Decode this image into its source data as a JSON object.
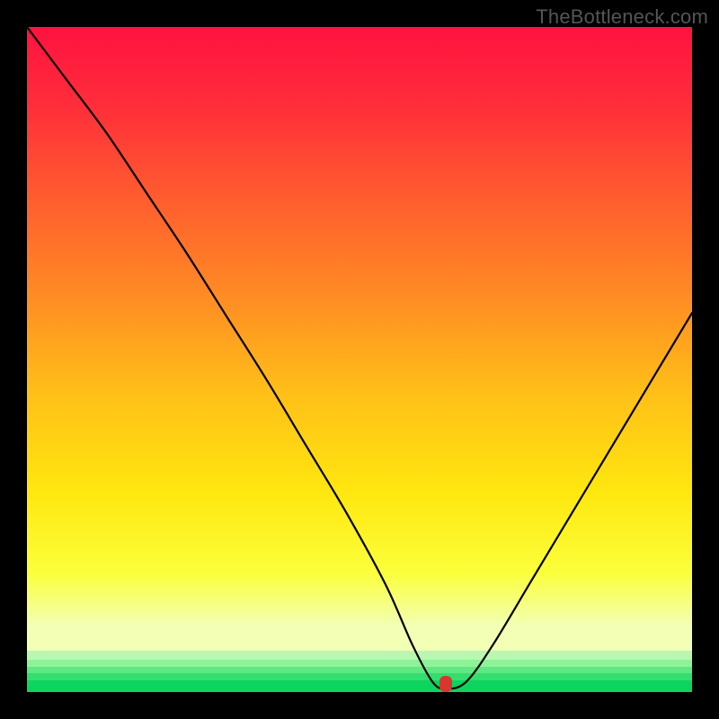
{
  "watermark": "TheBottleneck.com",
  "chart_data": {
    "type": "line",
    "title": "",
    "xlabel": "",
    "ylabel": "",
    "xlim": [
      0,
      100
    ],
    "ylim": [
      0,
      100
    ],
    "series": [
      {
        "name": "bottleneck-curve",
        "x": [
          0,
          6,
          12,
          18,
          24,
          30,
          36,
          42,
          48,
          54,
          58,
          61,
          63,
          66,
          70,
          76,
          82,
          88,
          94,
          100
        ],
        "y": [
          100,
          92,
          84,
          75,
          66,
          56.5,
          47,
          37,
          27,
          16,
          7,
          1.5,
          0.5,
          1.5,
          7,
          17,
          27,
          37,
          47,
          57
        ]
      }
    ],
    "marker": {
      "x": 63,
      "y": 1.2,
      "color": "#d9362e"
    },
    "gradient_stops": [
      {
        "offset": 0.0,
        "color": "#ff1240"
      },
      {
        "offset": 0.12,
        "color": "#ff2e3a"
      },
      {
        "offset": 0.25,
        "color": "#ff5a2f"
      },
      {
        "offset": 0.4,
        "color": "#ff8a24"
      },
      {
        "offset": 0.55,
        "color": "#ffbf18"
      },
      {
        "offset": 0.7,
        "color": "#ffe70f"
      },
      {
        "offset": 0.82,
        "color": "#fbff3a"
      },
      {
        "offset": 0.9,
        "color": "#f2ffb4"
      },
      {
        "offset": 1.0,
        "color": "#f2ffb4"
      }
    ],
    "green_bands": [
      {
        "top_pct": 93.8,
        "height_pct": 1.3,
        "color": "#b9f7b1"
      },
      {
        "top_pct": 95.1,
        "height_pct": 1.1,
        "color": "#8ef298"
      },
      {
        "top_pct": 96.2,
        "height_pct": 1.0,
        "color": "#5fe881"
      },
      {
        "top_pct": 97.2,
        "height_pct": 1.0,
        "color": "#33de6e"
      },
      {
        "top_pct": 98.2,
        "height_pct": 1.8,
        "color": "#0cd45e"
      }
    ]
  }
}
